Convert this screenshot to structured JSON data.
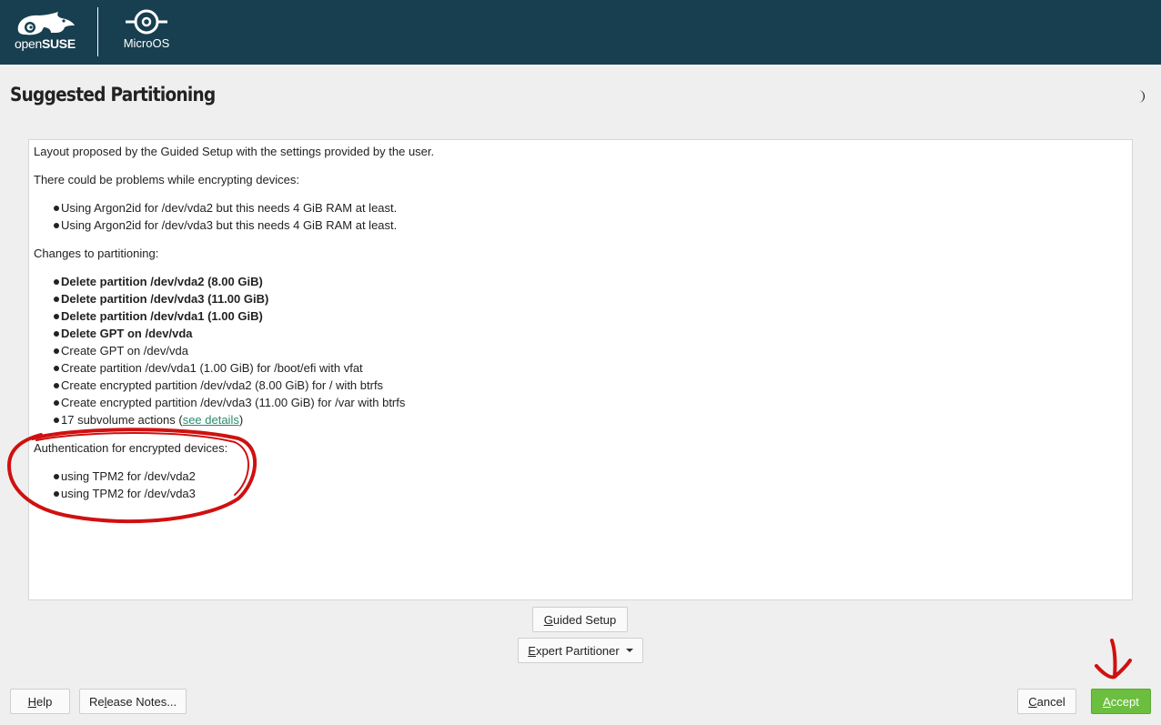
{
  "header": {
    "logo_text_prefix": "open",
    "logo_text_bold": "SUSE",
    "product_name": "MicroOS"
  },
  "page": {
    "title": "Suggested Partitioning"
  },
  "summary": {
    "intro": "Layout proposed by the Guided Setup with the settings provided by the user.",
    "problems_heading": "There could be problems while encrypting devices:",
    "problems": [
      "Using Argon2id for /dev/vda2 but this needs 4 GiB RAM at least.",
      "Using Argon2id for /dev/vda3 but this needs 4 GiB RAM at least."
    ],
    "changes_heading": "Changes to partitioning:",
    "changes": [
      "Delete partition /dev/vda2 (8.00 GiB)",
      "Delete partition /dev/vda3 (11.00 GiB)",
      "Delete partition /dev/vda1 (1.00 GiB)",
      "Delete GPT on /dev/vda",
      "Create GPT on /dev/vda",
      "Create partition /dev/vda1 (1.00 GiB) for /boot/efi with vfat",
      "Create encrypted partition /dev/vda2 (8.00 GiB) for / with btrfs",
      "Create encrypted partition /dev/vda3 (11.00 GiB) for /var with btrfs"
    ],
    "subvolume_prefix": "17 subvolume actions (",
    "subvolume_link": "see details",
    "subvolume_suffix": ")",
    "auth_heading": "Authentication for encrypted devices:",
    "auth_items": [
      "using TPM2 for /dev/vda2",
      "using TPM2 for /dev/vda3"
    ]
  },
  "actions": {
    "guided_setup_accel": "G",
    "guided_setup_rest": "uided Setup",
    "expert_accel": "E",
    "expert_rest": "xpert Partitioner",
    "help_accel": "H",
    "help_rest": "elp",
    "release_pre": "Re",
    "release_accel": "l",
    "release_rest": "ease Notes...",
    "cancel_accel": "C",
    "cancel_rest": "ancel",
    "accept_accel": "A",
    "accept_rest": "ccept"
  },
  "colors": {
    "header_bg": "#173f4f",
    "accept_bg": "#6cbe3f",
    "link": "#2a8a6e",
    "annotation": "#d01010"
  }
}
